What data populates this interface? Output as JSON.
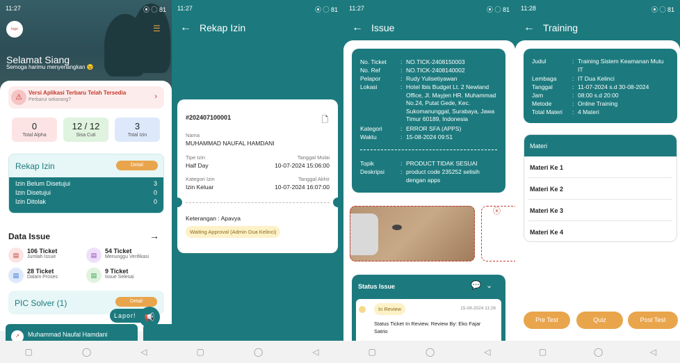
{
  "s1": {
    "time": "11:27",
    "sb_right": "⦿ ◯ 81",
    "greeting": "Selamat Siang",
    "subgreet": "Semoga harimu menyenangkan 😉",
    "update_title": "Versi Aplikasi Terbaru Telah Tersedia",
    "update_sub": "Perbarui sekarang?",
    "stats": [
      {
        "value": "0",
        "label": "Total Alpha"
      },
      {
        "value": "12 / 12",
        "label": "Sisa Cuti"
      },
      {
        "value": "3",
        "label": "Total Izin"
      }
    ],
    "rekap_title": "Rekap Izin",
    "detail": "Detail",
    "rekap_rows": [
      {
        "label": "Izin Belum Disetujui",
        "value": "3"
      },
      {
        "label": "Izin Disetujui",
        "value": "0"
      },
      {
        "label": "Izin Ditolak",
        "value": "0"
      }
    ],
    "data_issue": "Data Issue",
    "issues": [
      {
        "count": "106 Ticket",
        "label": "Jumlah Issue"
      },
      {
        "count": "54 Ticket",
        "label": "Menunggu Verifikasi"
      },
      {
        "count": "28 Ticket",
        "label": "Dalam Proses"
      },
      {
        "count": "9 Ticket",
        "label": "Issue Selesai"
      }
    ],
    "pic": "PIC Solver (1)",
    "lapor": "Lapor!",
    "person": "Muhammad Naufal Hamdani"
  },
  "s2": {
    "time": "11:27",
    "title": "Rekap Izin",
    "ticket_no": "#202407100001",
    "nama_l": "Nama",
    "nama": "MUHAMMAD NAUFAL HAMDANI",
    "tipe_l": "Tipe Izin",
    "tipe": "Half Day",
    "tm_l": "Tanggal Mulai",
    "tm": "10-07-2024 15:06:00",
    "kat_l": "Kategori Izin",
    "kat": "Izin Keluar",
    "ta_l": "Tanggal Akhir",
    "ta": "10-07-2024 16:07:00",
    "ket": "Keterangan : Apavya",
    "status": "Waiting Approval (Admin Dua Kelinci)"
  },
  "s3": {
    "time": "11:27",
    "title": "Issue",
    "rows": [
      {
        "k": "No. Ticket",
        "v": "NO.TICK-2408150003"
      },
      {
        "k": "No. Ref",
        "v": "NO.TICK-2408140002"
      },
      {
        "k": "Pelapor",
        "v": "Rudy Yulisetiyawan"
      },
      {
        "k": "Lokasi",
        "v": "Hotel Ibis Budget Lt. 2 Newland Office, Jl. Mayjen HR. Muhammad No.24, Putat Gede, Kec. Sukomanunggal, Surabaya, Jawa Timur 60189, Indonesia"
      },
      {
        "k": "Kategori",
        "v": "ERROR SFA (APPS)"
      },
      {
        "k": "Waktu",
        "v": "15-08-2024 09:51"
      }
    ],
    "rows2": [
      {
        "k": "Topik",
        "v": "PRODUCT TIDAK SESUAI"
      },
      {
        "k": "Deskripsi",
        "v": "product code 235252 selisih dengan apps"
      }
    ],
    "status_title": "Status Issue",
    "review": "In Review",
    "review_date": "15-08-2024 11:26",
    "review_text": "Status Ticket In Review. Review By: Eko Fajar Satrio"
  },
  "s4": {
    "time": "11:28",
    "title": "Training",
    "rows": [
      {
        "k": "Judul",
        "v": "Training Sistem Keamanan Mutu IT"
      },
      {
        "k": "Lembaga",
        "v": "IT Dua Kelinci"
      },
      {
        "k": "Tanggal",
        "v": "11-07-2024 s.d 30-08-2024"
      },
      {
        "k": "Jam",
        "v": "08:00 s.d 20:00"
      },
      {
        "k": "Metode",
        "v": "Online Training"
      },
      {
        "k": "Total Materi",
        "v": "4 Materi"
      }
    ],
    "materi_title": "Materi",
    "materi": [
      "Materi Ke 1",
      "Materi Ke 2",
      "Materi Ke 3",
      "Materi Ke 4"
    ],
    "buttons": [
      "Pre Test",
      "Quiz",
      "Post Test"
    ]
  }
}
